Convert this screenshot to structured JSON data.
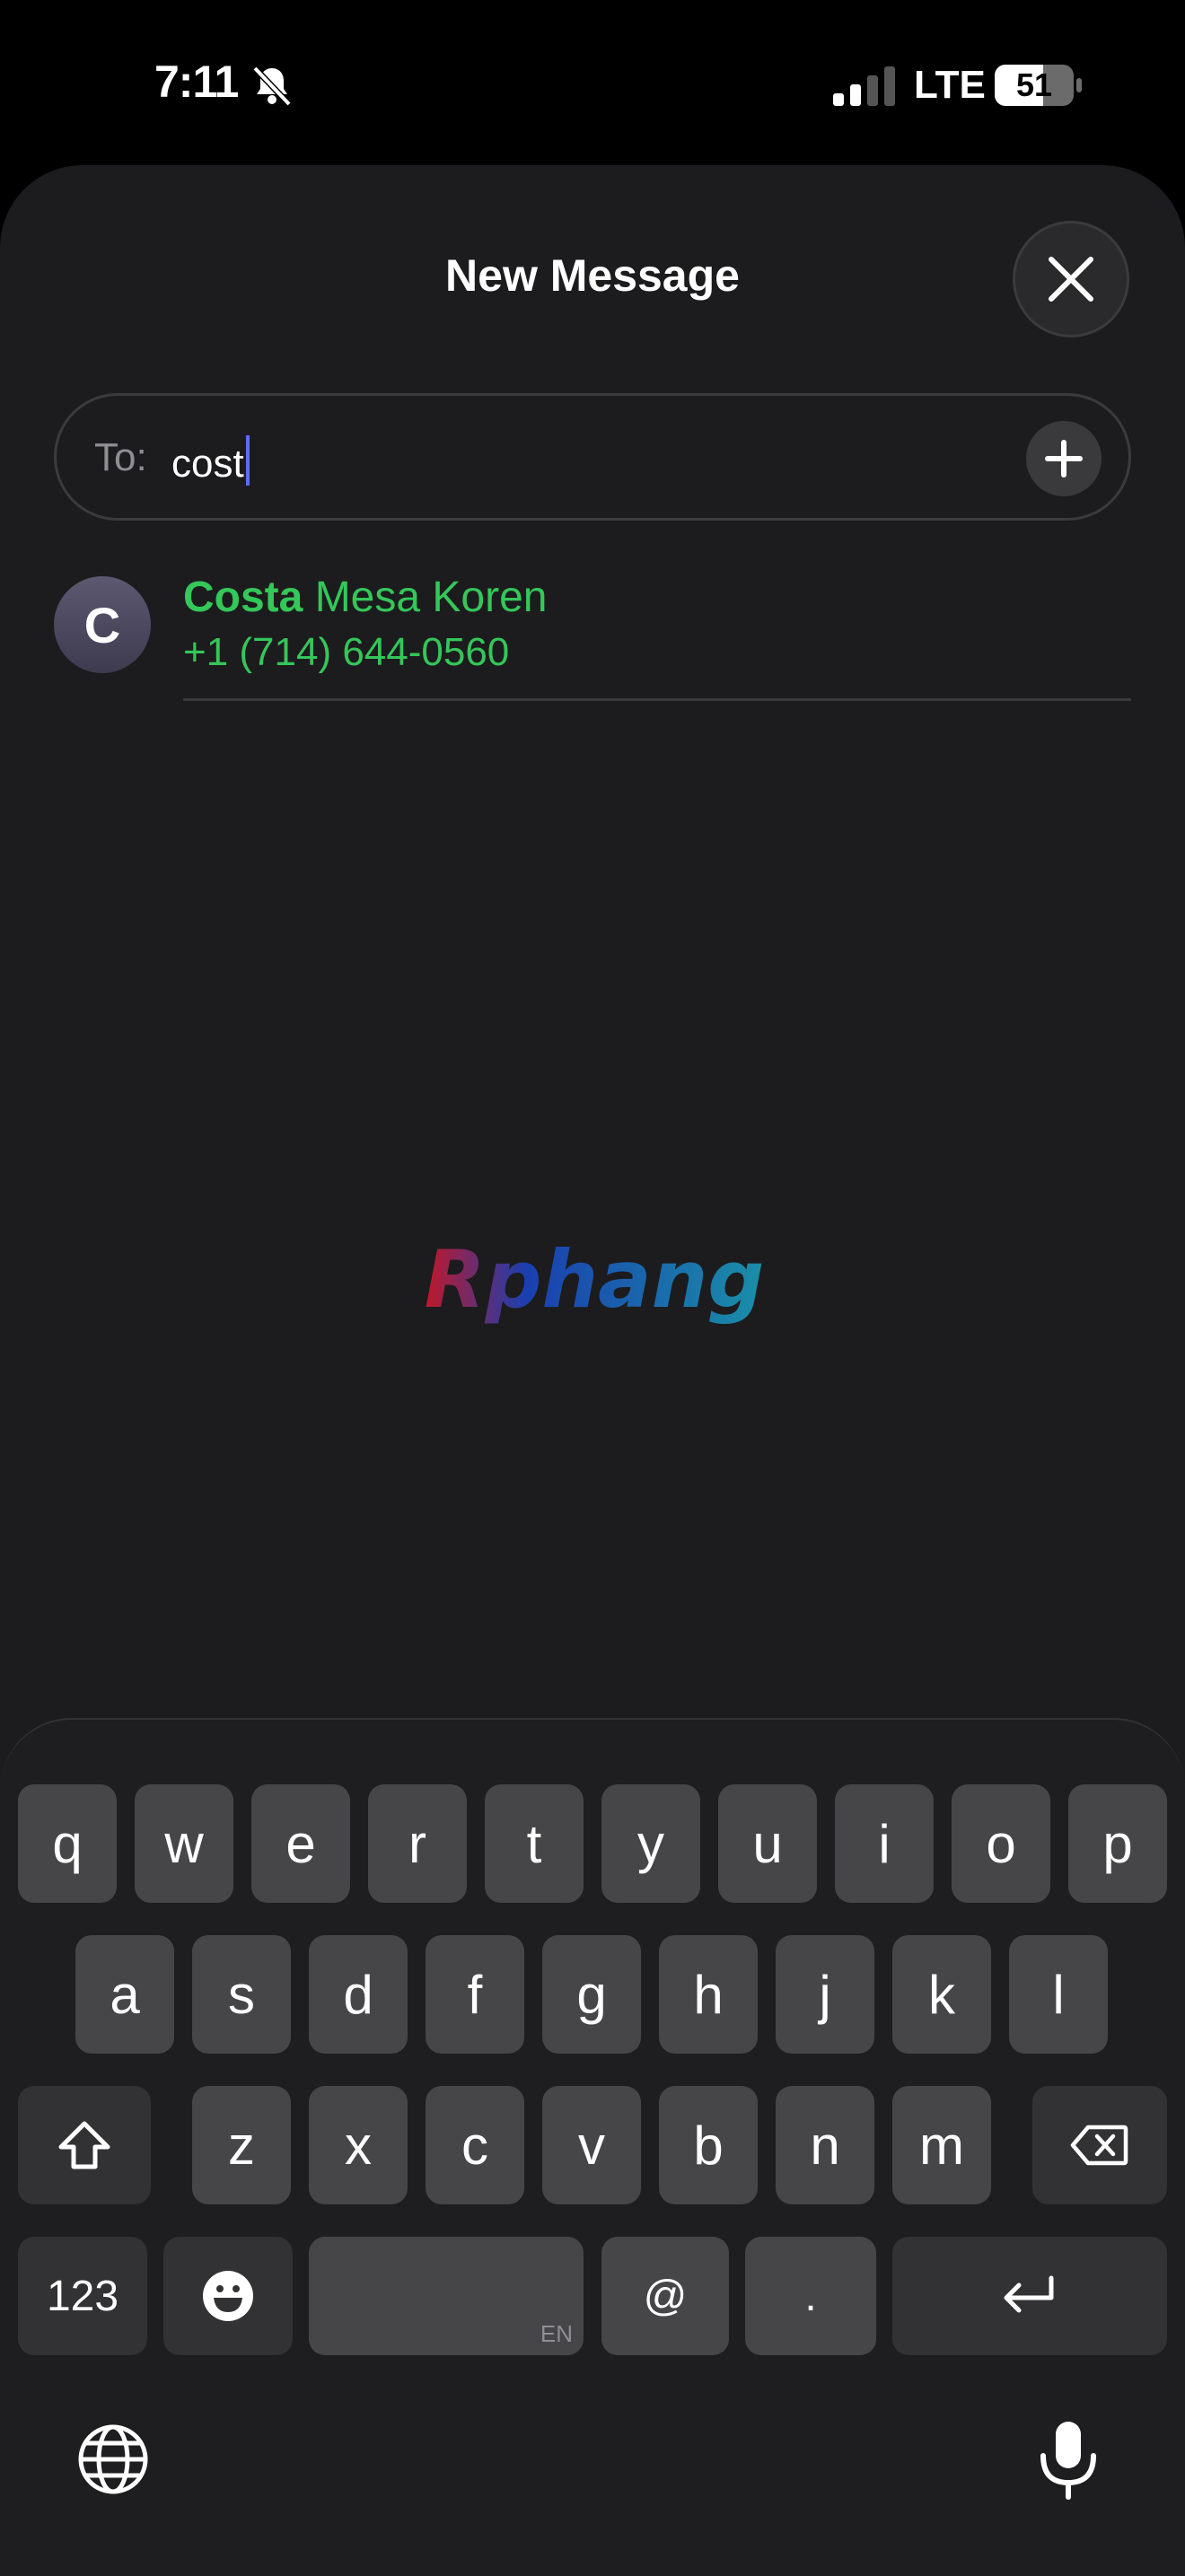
{
  "status": {
    "time": "7:11",
    "network": "LTE",
    "battery": "51"
  },
  "sheet": {
    "title": "New Message"
  },
  "to_field": {
    "label": "To:",
    "value": "cost"
  },
  "suggestion": {
    "initial": "C",
    "name_match": "Costa",
    "name_rest": " Mesa Koren",
    "phone": "+1 (714) 644-0560"
  },
  "watermark": "Rphang",
  "keyboard": {
    "row1": [
      "q",
      "w",
      "e",
      "r",
      "t",
      "y",
      "u",
      "i",
      "o",
      "p"
    ],
    "row2": [
      "a",
      "s",
      "d",
      "f",
      "g",
      "h",
      "j",
      "k",
      "l"
    ],
    "row3": [
      "z",
      "x",
      "c",
      "v",
      "b",
      "n",
      "m"
    ],
    "numbers_key": "123",
    "at_key": "@",
    "dot_key": ".",
    "space_lang": "EN"
  },
  "icons": [
    "bell-slash-icon",
    "signal-icon",
    "battery-icon",
    "close-icon",
    "plus-icon",
    "shift-icon",
    "delete-icon",
    "emoji-icon",
    "return-icon",
    "globe-icon",
    "mic-icon"
  ]
}
